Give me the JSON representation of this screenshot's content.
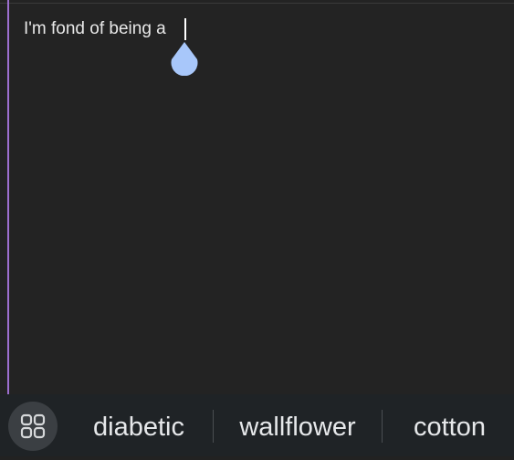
{
  "editor": {
    "text": "I'm fond of being a"
  },
  "keyboard": {
    "apps_icon": "grid-icon",
    "suggestions": [
      "diabetic",
      "wallflower",
      "cotton"
    ]
  },
  "colors": {
    "background": "#232323",
    "accent_edge": "#9c6fcf",
    "cursor_handle": "#a8c7fa",
    "suggestion_bar": "#1f2326"
  }
}
